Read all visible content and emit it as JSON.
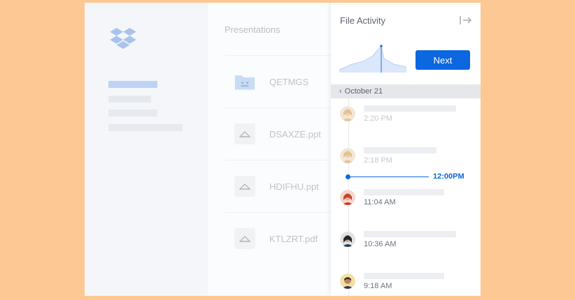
{
  "sidebar": {
    "logo_icon": "dropbox-logo-icon",
    "nav_items": [
      "active",
      "item",
      "item",
      "item"
    ]
  },
  "files": {
    "title": "Presentations",
    "items": [
      {
        "name": "QETMGS",
        "icon": "folder-icon"
      },
      {
        "name": "DSAXZE.ppt",
        "icon": "file-icon"
      },
      {
        "name": "HDIFHU.ppt",
        "icon": "file-icon"
      },
      {
        "name": "KTLZRT.pdf",
        "icon": "file-icon"
      }
    ]
  },
  "panel": {
    "title": "File Activity",
    "collapse_icon": "collapse-panel-icon",
    "next_label": "Next",
    "date": "October 21",
    "now_label": "12:00PM",
    "activities": [
      {
        "time": "2:20 PM",
        "faded": true,
        "avatar": "avatar-blonde"
      },
      {
        "time": "2:18 PM",
        "faded": true,
        "avatar": "avatar-blonde"
      },
      {
        "time": "11:04 AM",
        "faded": false,
        "avatar": "avatar-red"
      },
      {
        "time": "10:36 AM",
        "faded": false,
        "avatar": "avatar-dark"
      },
      {
        "time": "9:18 AM",
        "faded": false,
        "avatar": "avatar-yellow"
      }
    ]
  },
  "colors": {
    "background": "#fdc893",
    "accent": "#0c67e0",
    "sparkline_fill": "#dbe7fa"
  }
}
